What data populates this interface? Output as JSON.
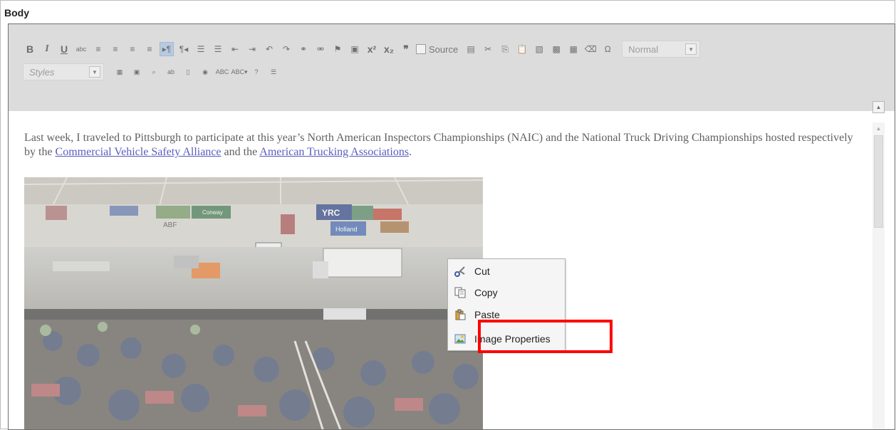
{
  "section_label": "Body",
  "toolbar": {
    "row1_buttons": [
      {
        "name": "bold-button",
        "glyph": "B",
        "cls": "b"
      },
      {
        "name": "italic-button",
        "glyph": "I",
        "cls": "i"
      },
      {
        "name": "underline-button",
        "glyph": "U",
        "cls": "u"
      },
      {
        "name": "strikethrough-button",
        "glyph": "abc",
        "cls": "small"
      },
      {
        "name": "align-left-button",
        "glyph": "≡",
        "cls": ""
      },
      {
        "name": "align-center-button",
        "glyph": "≡",
        "cls": ""
      },
      {
        "name": "align-right-button",
        "glyph": "≡",
        "cls": ""
      },
      {
        "name": "justify-button",
        "glyph": "≡",
        "cls": ""
      },
      {
        "name": "ltr-button",
        "glyph": "▸¶",
        "cls": "active"
      },
      {
        "name": "rtl-button",
        "glyph": "¶◂",
        "cls": ""
      },
      {
        "name": "bulleted-list-button",
        "glyph": "☰",
        "cls": ""
      },
      {
        "name": "numbered-list-button",
        "glyph": "☰",
        "cls": ""
      },
      {
        "name": "outdent-button",
        "glyph": "⇤",
        "cls": ""
      },
      {
        "name": "indent-button",
        "glyph": "⇥",
        "cls": ""
      },
      {
        "name": "undo-button",
        "glyph": "↶",
        "cls": ""
      },
      {
        "name": "redo-button",
        "glyph": "↷",
        "cls": ""
      },
      {
        "name": "link-button",
        "glyph": "⚭",
        "cls": ""
      },
      {
        "name": "unlink-button",
        "glyph": "⚮",
        "cls": ""
      },
      {
        "name": "anchor-button",
        "glyph": "⚑",
        "cls": ""
      },
      {
        "name": "image-button",
        "glyph": "▣",
        "cls": ""
      },
      {
        "name": "superscript-button",
        "glyph": "x²",
        "cls": "b"
      },
      {
        "name": "subscript-button",
        "glyph": "x₂",
        "cls": "b"
      },
      {
        "name": "blockquote-button",
        "glyph": "❞",
        "cls": "b"
      }
    ],
    "source_label": "Source",
    "row1_tail_buttons": [
      {
        "name": "maximize-button",
        "glyph": "▤"
      },
      {
        "name": "cut-button",
        "glyph": "✂"
      },
      {
        "name": "copy-button",
        "glyph": "⎘"
      },
      {
        "name": "paste-button",
        "glyph": "📋"
      },
      {
        "name": "paste-text-button",
        "glyph": "▧"
      },
      {
        "name": "paste-word-button",
        "glyph": "▩"
      },
      {
        "name": "paste-from-image-button",
        "glyph": "▦"
      },
      {
        "name": "remove-format-button",
        "glyph": "⌫"
      },
      {
        "name": "special-char-button",
        "glyph": "Ω"
      }
    ],
    "format_select": "Normal",
    "styles_select": "Styles",
    "row2_buttons": [
      {
        "name": "table-button",
        "glyph": "▦"
      },
      {
        "name": "select-all-button",
        "glyph": "▣"
      },
      {
        "name": "find-button",
        "glyph": "⌕"
      },
      {
        "name": "replace-button",
        "glyph": "ab"
      },
      {
        "name": "show-blocks-button",
        "glyph": "▯"
      },
      {
        "name": "iframe-button",
        "glyph": "◉"
      },
      {
        "name": "spellcheck-button",
        "glyph": "ABC"
      },
      {
        "name": "scayt-button",
        "glyph": "ABC▾"
      },
      {
        "name": "help-button",
        "glyph": "?"
      },
      {
        "name": "horizontal-rule-button",
        "glyph": "☰"
      }
    ]
  },
  "content": {
    "para_before": "Last week, I traveled to Pittsburgh to participate at this year’s North American Inspectors Championships (NAIC) and the National Truck Driving Championships hosted respectively by the ",
    "link1": "Commercial Vehicle Safety Alliance",
    "para_mid": " and the ",
    "link2": "American Trucking Associations",
    "para_end": "."
  },
  "photo_banners": {
    "yrc": "YRC",
    "abf": "ABF",
    "holland": "Holland",
    "conway": "Conway"
  },
  "context_menu": {
    "items": [
      {
        "label": "Cut",
        "icon": "scissors-icon"
      },
      {
        "label": "Copy",
        "icon": "copy-icon"
      },
      {
        "label": "Paste",
        "icon": "paste-icon"
      },
      {
        "label": "Image Properties",
        "icon": "image-icon"
      }
    ]
  },
  "colors": {
    "highlight": "#ff0000",
    "toolbar_bg": "#cfcfcf",
    "link": "#1a1aa6"
  }
}
